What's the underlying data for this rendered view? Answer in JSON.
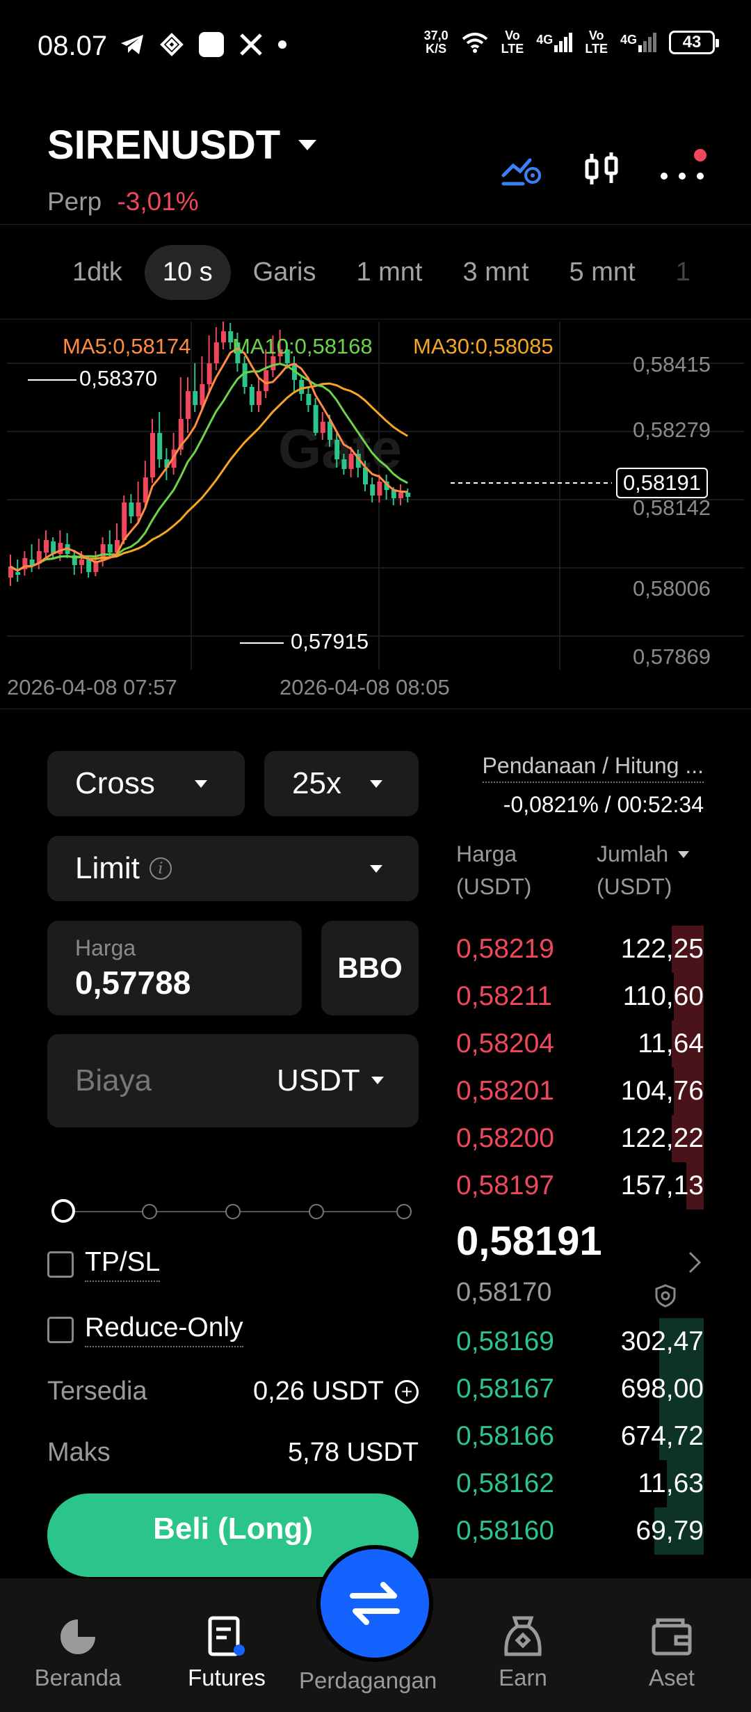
{
  "status_bar": {
    "time": "08.07",
    "net_speed_value": "37,0",
    "net_speed_unit": "K/S",
    "sim1_top": "Vo",
    "sim1_bottom": "LTE",
    "sim1_net": "4G",
    "sim2_top": "Vo",
    "sim2_bottom": "LTE",
    "sim2_net": "4G",
    "battery": "43",
    "icons": [
      "telegram-icon",
      "binance-icon",
      "app-square-icon",
      "x-icon",
      "dot-icon",
      "wifi-icon",
      "signal-icon",
      "battery-icon"
    ]
  },
  "header": {
    "pair": "SIRENUSDT",
    "type": "Perp",
    "change": "-3,01%",
    "icons": [
      "chart-settings-icon",
      "candlestick-icon",
      "more-icon"
    ]
  },
  "intervals": {
    "tabs": [
      "1dtk",
      "10 s",
      "Garis",
      "1 mnt",
      "3 mnt",
      "5 mnt",
      "1"
    ],
    "active": "10 s"
  },
  "chart": {
    "ma5": "MA5:0,58174",
    "ma10": "MA10:0,58168",
    "ma30": "MA30:0,58085",
    "y_ticks": [
      "0,58415",
      "0,58279",
      "0,58142",
      "0,58006",
      "0,57869"
    ],
    "x_ticks": [
      "2026-04-08 07:57",
      "2026-04-08 08:05"
    ],
    "high_label": "0,58370",
    "low_label": "0,57915",
    "current_price": "0,58191",
    "watermark": "Gate",
    "colors": {
      "up": "#2bc48a",
      "down": "#f0475c",
      "ma5": "#ff8c42",
      "ma10": "#6bd44a",
      "ma30": "#f5a623"
    }
  },
  "order_form": {
    "margin_mode": "Cross",
    "leverage": "25x",
    "order_type": "Limit",
    "price_label": "Harga",
    "price_value": "0,57788",
    "bbo": "BBO",
    "cost_placeholder": "Biaya",
    "cost_unit": "USDT",
    "tpsl": "TP/SL",
    "reduce_only": "Reduce-Only",
    "available_label": "Tersedia",
    "available_value": "0,26 USDT",
    "max_label": "Maks",
    "max_value": "5,78 USDT",
    "buy_button": "Beli (Long)"
  },
  "orderbook": {
    "funding_label": "Pendanaan / Hitung ...",
    "funding_value": "-0,0821% / 00:52:34",
    "price_header": "Harga",
    "price_unit": "(USDT)",
    "amount_header": "Jumlah",
    "amount_unit": "(USDT)",
    "asks": [
      {
        "price": "0,58219",
        "amount": "122,25",
        "depth": 0.13
      },
      {
        "price": "0,58211",
        "amount": "110,60",
        "depth": 0.12
      },
      {
        "price": "0,58204",
        "amount": "11,64",
        "depth": 0.13
      },
      {
        "price": "0,58201",
        "amount": "104,76",
        "depth": 0.12
      },
      {
        "price": "0,58200",
        "amount": "122,22",
        "depth": 0.13
      },
      {
        "price": "0,58197",
        "amount": "157,13",
        "depth": 0.07
      }
    ],
    "last_price": "0,58191",
    "mark_price": "0,58170",
    "bids": [
      {
        "price": "0,58169",
        "amount": "302,47",
        "depth": 0.18
      },
      {
        "price": "0,58167",
        "amount": "698,00",
        "depth": 0.18
      },
      {
        "price": "0,58166",
        "amount": "674,72",
        "depth": 0.18
      },
      {
        "price": "0,58162",
        "amount": "11,63",
        "depth": 0.15
      },
      {
        "price": "0,58160",
        "amount": "69,79",
        "depth": 0.2
      }
    ]
  },
  "nav": {
    "items": [
      {
        "label": "Beranda",
        "icon": "home-icon"
      },
      {
        "label": "Futures",
        "icon": "futures-icon"
      },
      {
        "label": "Perdagangan",
        "icon": "swap-icon"
      },
      {
        "label": "Earn",
        "icon": "earn-icon"
      },
      {
        "label": "Aset",
        "icon": "wallet-icon"
      }
    ],
    "active": "Futures"
  }
}
